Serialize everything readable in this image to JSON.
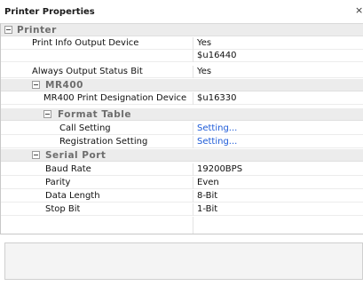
{
  "header": {
    "title": "Printer Properties",
    "close_glyph": "×"
  },
  "categories": {
    "printer": "Printer",
    "mr400": "MR400",
    "format_table": "Format Table",
    "serial_port": "Serial Port"
  },
  "props": {
    "print_info_output_device": {
      "label": "Print Info Output Device",
      "value": "Yes"
    },
    "print_info_output_device_address": {
      "label": "",
      "value": "$u16440"
    },
    "always_output_status_bit": {
      "label": "Always Output Status Bit",
      "value": "Yes"
    },
    "mr400_print_designation_device": {
      "label": "MR400 Print Designation Device",
      "value": "$u16330"
    },
    "call_setting": {
      "label": "Call Setting",
      "value": "Setting..."
    },
    "registration_setting": {
      "label": "Registration Setting",
      "value": "Setting..."
    },
    "baud_rate": {
      "label": "Baud Rate",
      "value": "19200BPS"
    },
    "parity": {
      "label": "Parity",
      "value": "Even"
    },
    "data_length": {
      "label": "Data Length",
      "value": "8-Bit"
    },
    "stop_bit": {
      "label": "Stop Bit",
      "value": "1-Bit"
    }
  },
  "colors": {
    "link": "#1e5bd8",
    "category_bg": "#ececec",
    "category_text": "#6d6d6d"
  },
  "icons": {
    "collapse": "minus-box-icon"
  }
}
